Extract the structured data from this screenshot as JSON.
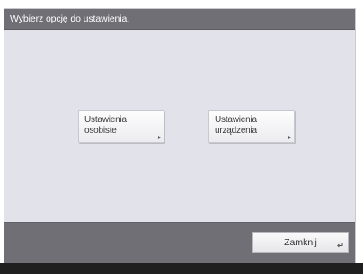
{
  "window": {
    "title": "Wybierz opcję do ustawienia."
  },
  "main": {
    "buttons": [
      {
        "label": "Ustawienia\nosobiste",
        "icon": "arrow-right-icon"
      },
      {
        "label": "Ustawienia\nurządzenia",
        "icon": "arrow-right-icon"
      }
    ]
  },
  "footer": {
    "close_label": "Zamknij",
    "close_icon": "return-icon"
  },
  "colors": {
    "title_bar": "#6f6f75",
    "background": "#e2e2ea",
    "button": "#f4f4f6"
  }
}
